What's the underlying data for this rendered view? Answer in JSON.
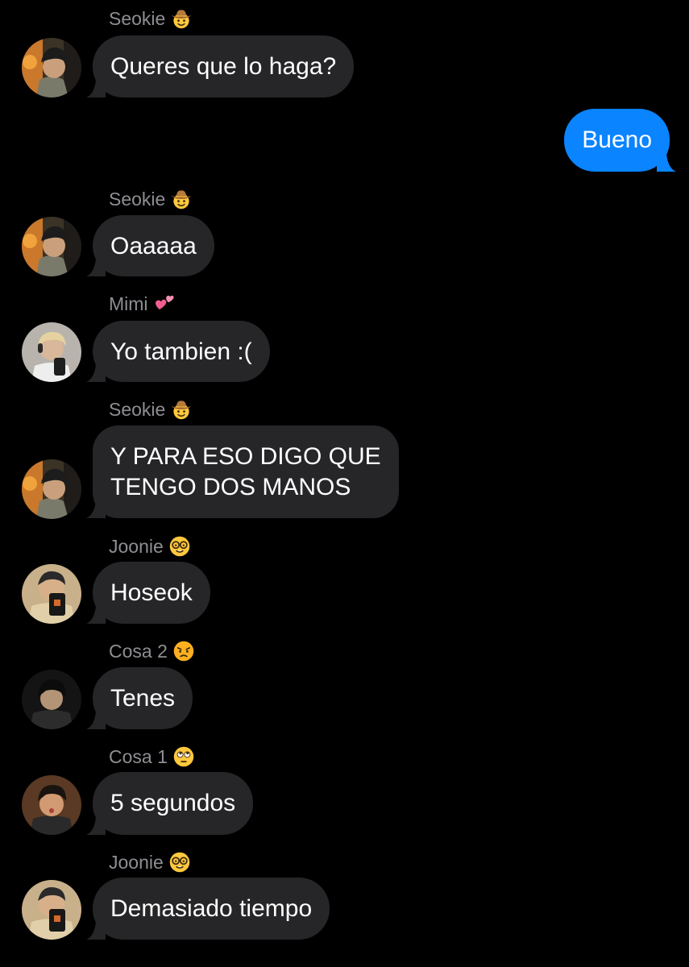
{
  "conversation": [
    {
      "type": "in",
      "sender": "Seokie",
      "sender_emoji": "cowboy-face",
      "text": "Queres que lo haga?",
      "avatar": "seokie-avatar"
    },
    {
      "type": "out",
      "text": "Bueno"
    },
    {
      "type": "in",
      "sender": "Seokie",
      "sender_emoji": "cowboy-face",
      "text": "Oaaaaa",
      "avatar": "seokie-avatar"
    },
    {
      "type": "in",
      "sender": "Mimi",
      "sender_emoji": "two-hearts",
      "text": "Yo tambien :(",
      "avatar": "mimi-avatar"
    },
    {
      "type": "in",
      "sender": "Seokie",
      "sender_emoji": "cowboy-face",
      "text_lines": [
        "Y PARA ESO DIGO QUE",
        "TENGO DOS MANOS"
      ],
      "avatar": "seokie-avatar"
    },
    {
      "type": "in",
      "sender": "Joonie",
      "sender_emoji": "nerd-face",
      "text": "Hoseok",
      "avatar": "joonie-avatar"
    },
    {
      "type": "in",
      "sender": "Cosa 2",
      "sender_emoji": "angry-face",
      "text": "Tenes",
      "avatar": "cosa2-avatar"
    },
    {
      "type": "in",
      "sender": "Cosa 1",
      "sender_emoji": "eye-roll-face",
      "text": "5 segundos",
      "avatar": "cosa1-avatar"
    },
    {
      "type": "in",
      "sender": "Joonie",
      "sender_emoji": "nerd-face",
      "text": "Demasiado tiempo",
      "avatar": "joonie-avatar"
    }
  ],
  "colors": {
    "background": "#000000",
    "incoming_bubble": "#262628",
    "outgoing_bubble": "#0a84ff",
    "sender_name": "#8e8e93",
    "text": "#ffffff"
  }
}
